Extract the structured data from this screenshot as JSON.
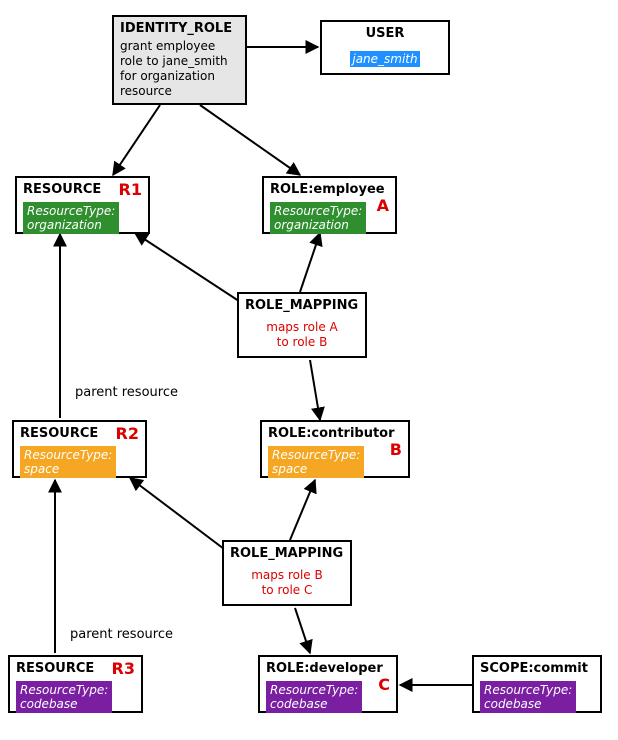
{
  "identity_role": {
    "title": "IDENTITY_ROLE",
    "desc": "grant employee role to jane_smith for organization resource"
  },
  "user": {
    "title": "USER",
    "name": "jane_smith"
  },
  "resources": {
    "r1": {
      "title": "RESOURCE",
      "letter": "R1",
      "type_line1": "ResourceType:",
      "type_line2": "organization"
    },
    "r2": {
      "title": "RESOURCE",
      "letter": "R2",
      "type_line1": "ResourceType:",
      "type_line2": "space"
    },
    "r3": {
      "title": "RESOURCE",
      "letter": "R3",
      "type_line1": "ResourceType:",
      "type_line2": "codebase"
    }
  },
  "roles": {
    "a": {
      "title": "ROLE:employee",
      "letter": "A",
      "type_line1": "ResourceType:",
      "type_line2": "organization"
    },
    "b": {
      "title": "ROLE:contributor",
      "letter": "B",
      "type_line1": "ResourceType:",
      "type_line2": "space"
    },
    "c": {
      "title": "ROLE:developer",
      "letter": "C",
      "type_line1": "ResourceType:",
      "type_line2": "codebase"
    }
  },
  "mappings": {
    "m1": {
      "title": "ROLE_MAPPING",
      "line1": "maps role A",
      "line2": "to role B"
    },
    "m2": {
      "title": "ROLE_MAPPING",
      "line1": "maps role B",
      "line2": "to role C"
    }
  },
  "scope": {
    "title": "SCOPE:commit",
    "type_line1": "ResourceType:",
    "type_line2": "codebase"
  },
  "edge_labels": {
    "parent1": "parent resource",
    "parent2": "parent resource"
  }
}
